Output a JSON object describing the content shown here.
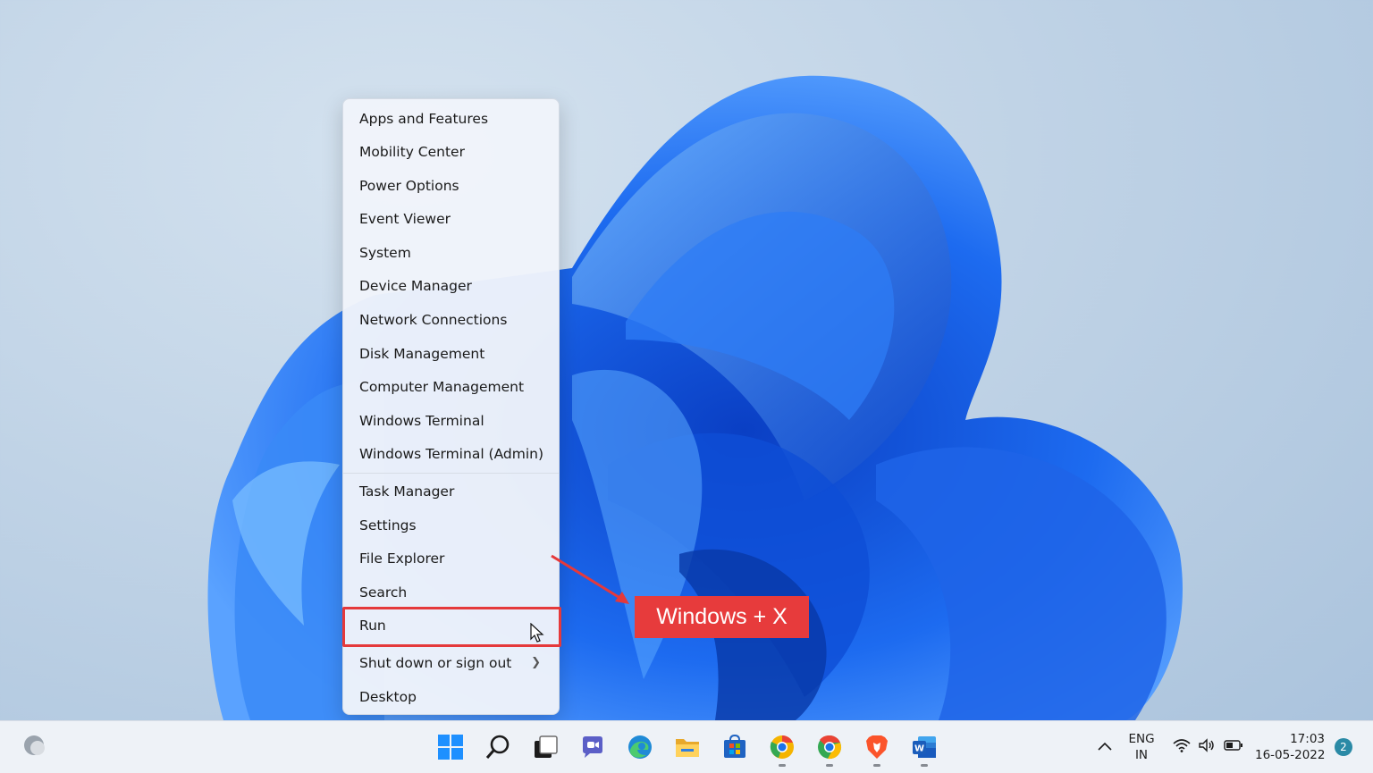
{
  "menu": {
    "items": [
      {
        "label": "Apps and Features"
      },
      {
        "label": "Mobility Center"
      },
      {
        "label": "Power Options"
      },
      {
        "label": "Event Viewer"
      },
      {
        "label": "System"
      },
      {
        "label": "Device Manager"
      },
      {
        "label": "Network Connections"
      },
      {
        "label": "Disk Management"
      },
      {
        "label": "Computer Management"
      },
      {
        "label": "Windows Terminal"
      },
      {
        "label": "Windows Terminal (Admin)"
      },
      {
        "label": "Task Manager"
      },
      {
        "label": "Settings"
      },
      {
        "label": "File Explorer"
      },
      {
        "label": "Search"
      },
      {
        "label": "Run"
      },
      {
        "label": "Shut down or sign out"
      },
      {
        "label": "Desktop"
      }
    ],
    "highlighted_item": "Run",
    "submenu_icon": "chevron-right-icon"
  },
  "callout": {
    "text": "Windows + X",
    "color": "#e73b3c"
  },
  "taskbar": {
    "apps": [
      {
        "name": "start",
        "icon": "windows-logo-icon"
      },
      {
        "name": "search",
        "icon": "search-icon"
      },
      {
        "name": "task-view",
        "icon": "task-view-icon"
      },
      {
        "name": "chat",
        "icon": "chat-icon"
      },
      {
        "name": "edge",
        "icon": "edge-icon"
      },
      {
        "name": "file-explorer",
        "icon": "folder-icon"
      },
      {
        "name": "store",
        "icon": "store-icon"
      },
      {
        "name": "chrome-canary",
        "icon": "chrome-canary-icon"
      },
      {
        "name": "chrome",
        "icon": "chrome-icon"
      },
      {
        "name": "brave",
        "icon": "brave-icon"
      },
      {
        "name": "word",
        "icon": "word-icon"
      }
    ],
    "tray": {
      "language_line1": "ENG",
      "language_line2": "IN",
      "time": "17:03",
      "date": "16-05-2022",
      "notification_count": "2"
    }
  }
}
